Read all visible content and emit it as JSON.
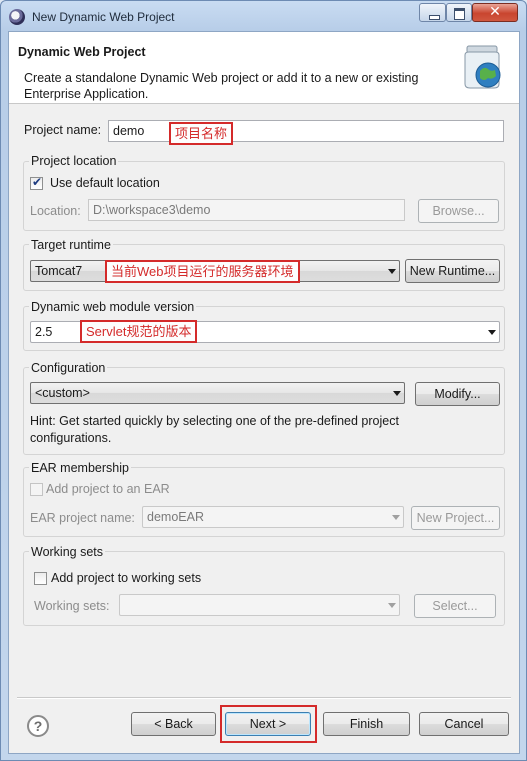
{
  "window": {
    "title": "New Dynamic Web Project",
    "close_glyph": "✕"
  },
  "header": {
    "title": "Dynamic Web Project",
    "description": "Create a standalone Dynamic Web project or add it to a new or existing Enterprise Application.",
    "icon": "web-project-jar-icon"
  },
  "project_name": {
    "label": "Project name:",
    "value": "demo",
    "annotation": "项目名称"
  },
  "project_location": {
    "group_label": "Project location",
    "use_default_label": "Use default location",
    "use_default_checked": true,
    "location_label": "Location:",
    "location_value": "D:\\workspace3\\demo",
    "browse_label": "Browse..."
  },
  "target_runtime": {
    "group_label": "Target runtime",
    "selected": "Tomcat7",
    "annotation": "当前Web项目运行的服务器环境",
    "new_runtime_label": "New Runtime..."
  },
  "module_version": {
    "group_label": "Dynamic web module version",
    "selected": "2.5",
    "annotation": "Servlet规范的版本"
  },
  "configuration": {
    "group_label": "Configuration",
    "selected": "<custom>",
    "modify_label": "Modify...",
    "hint": "Hint: Get started quickly by selecting one of the pre-defined project configurations."
  },
  "ear": {
    "group_label": "EAR membership",
    "add_label": "Add project to an EAR",
    "project_name_label": "EAR project name:",
    "project_name_value": "demoEAR",
    "new_project_label": "New Project..."
  },
  "working_sets": {
    "group_label": "Working sets",
    "add_label": "Add project to working sets",
    "sets_label": "Working sets:",
    "sets_value": "",
    "select_label": "Select..."
  },
  "footer": {
    "help_glyph": "?",
    "back_label": "< Back",
    "next_label": "Next >",
    "finish_label": "Finish",
    "cancel_label": "Cancel"
  },
  "colors": {
    "annotation": "#d42a2a",
    "title_bar": "#c9dcf2",
    "close_button": "#c9452f"
  }
}
